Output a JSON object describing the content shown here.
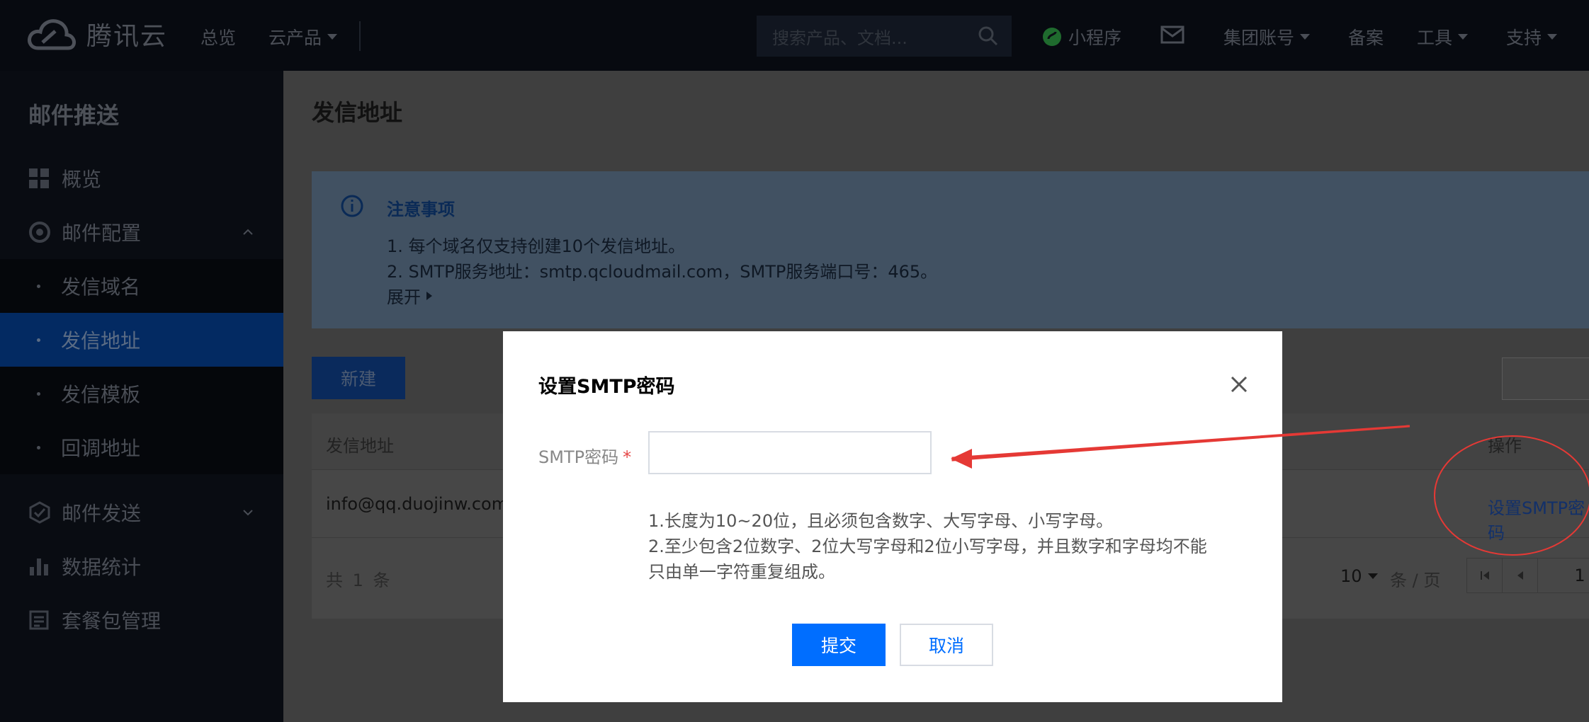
{
  "brand": {
    "name": "腾讯云"
  },
  "topnav": {
    "overview": "总览",
    "products": "云产品",
    "search_placeholder": "搜索产品、文档...",
    "miniprogram": "小程序",
    "group_account": "集团账号",
    "filing": "备案",
    "tools": "工具",
    "support": "支持"
  },
  "sidebar": {
    "title": "邮件推送",
    "items": [
      {
        "label": "概览",
        "icon": "grid-icon"
      },
      {
        "label": "邮件配置",
        "icon": "mail-config-icon",
        "expanded": true
      },
      {
        "label": "发信域名"
      },
      {
        "label": "发信地址",
        "active": true
      },
      {
        "label": "发信模板"
      },
      {
        "label": "回调地址"
      },
      {
        "label": "邮件发送",
        "icon": "send-icon",
        "expanded": false
      },
      {
        "label": "数据统计",
        "icon": "bar-chart-icon"
      },
      {
        "label": "套餐包管理",
        "icon": "package-icon"
      }
    ]
  },
  "main": {
    "title": "发信地址",
    "notice": {
      "title": "注意事项",
      "line1": "1. 每个域名仅支持创建10个发信地址。",
      "line2": "2. SMTP服务地址：smtp.qcloudmail.com，SMTP服务端口号：465。",
      "expand": "展开"
    },
    "new_button": "新建",
    "table": {
      "columns": [
        "发信地址",
        "操作"
      ],
      "rows": [
        {
          "address": "info@qq.duojinw.com",
          "action": "设置SMTP密码"
        }
      ],
      "total_text": "共 1 条",
      "page_size": "10",
      "per_page": "条 / 页",
      "current_page": "1"
    }
  },
  "modal": {
    "title": "设置SMTP密码",
    "field_label": "SMTP密码",
    "required_mark": "*",
    "password_value": "",
    "hint1": "1.长度为10~20位，且必须包含数字、大写字母、小写字母。",
    "hint2": "2.至少包含2位数字、2位大写字母和2位小写字母，并且数字和字母均不能",
    "hint3": "只由单一字符重复组成。",
    "submit": "提交",
    "cancel": "取消"
  },
  "colors": {
    "primary": "#006eff",
    "required": "#e54545",
    "annotation": "#e53935"
  }
}
